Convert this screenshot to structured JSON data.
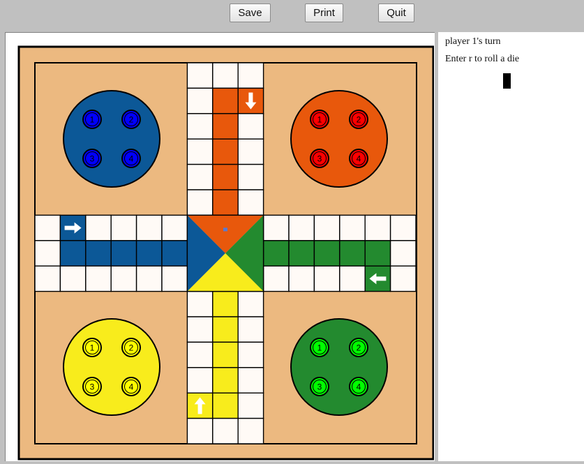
{
  "toolbar": {
    "save_label": "Save",
    "print_label": "Print",
    "quit_label": "Quit"
  },
  "status": {
    "turn_text": "player 1's turn",
    "prompt_text": "Enter r to roll a die"
  },
  "colors": {
    "blue": "#0c5897",
    "orange": "#e8580c",
    "green": "#238a2f",
    "yellow": "#f8ec1c",
    "board_bg": "#ecb980",
    "cell": "#fffaf6",
    "blue_token": "#0000ff",
    "red_token": "#ff0000",
    "yellow_token": "#ffff00",
    "green_token": "#00ff00"
  },
  "players": [
    {
      "name": "blue",
      "tokens": [
        "1",
        "2",
        "3",
        "4"
      ]
    },
    {
      "name": "orange",
      "tokens": [
        "1",
        "2",
        "3",
        "4"
      ]
    },
    {
      "name": "yellow",
      "tokens": [
        "1",
        "2",
        "3",
        "4"
      ]
    },
    {
      "name": "green",
      "tokens": [
        "1",
        "2",
        "3",
        "4"
      ]
    }
  ],
  "arrows": [
    "right-arrow-icon",
    "down-arrow-icon",
    "left-arrow-icon",
    "up-arrow-icon"
  ]
}
